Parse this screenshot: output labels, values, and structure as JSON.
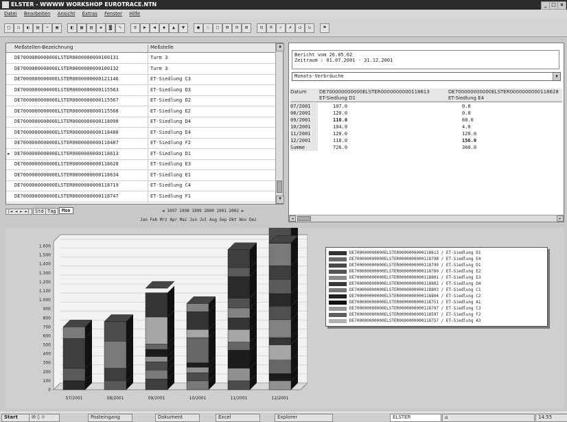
{
  "window": {
    "title": "ELSTER - WWWW WORKSHOP EUROTRACE.NTN"
  },
  "menu": [
    "Datei",
    "Bearbeiten",
    "Ansicht",
    "Extras",
    "Fenster",
    "Hilfe"
  ],
  "list": {
    "headers": [
      "Meßstellen-Bezeichnung",
      "Meßstelle"
    ],
    "rows": [
      {
        "id": "DE700000000000ELSTER0000000000100131",
        "name": "Turm 3"
      },
      {
        "id": "DE700000000000ELSTER0000000000100132",
        "name": "Turm 3"
      },
      {
        "id": "DE700000000000ELSTER0000000000121146",
        "name": "ET-Siedlung C3"
      },
      {
        "id": "DE700000000000ELSTER0000000000115563",
        "name": "ET-Siedlung D3"
      },
      {
        "id": "DE700000000000ELSTER0000000000115567",
        "name": "ET-Siedlung D2"
      },
      {
        "id": "DE700000000000ELSTER0000000000115568",
        "name": "ET-Siedlung E2"
      },
      {
        "id": "DE700000000000ELSTER0000000000118090",
        "name": "ET-Siedlung D4"
      },
      {
        "id": "DE700000000000ELSTER0000000000118480",
        "name": "ET-Siedlung E4"
      },
      {
        "id": "DE700000000000ELSTER0000000000118487",
        "name": "ET-Siedlung F2"
      },
      {
        "id": "DE700000000000ELSTER0000000000118613",
        "name": "ET-Siedlung D1"
      },
      {
        "id": "DE700000000000ELSTER0000000000118628",
        "name": "ET-Siedlung E3"
      },
      {
        "id": "DE700000000000ELSTER0000000000118634",
        "name": "ET-Siedlung E1"
      },
      {
        "id": "DE700000000000ELSTER0000000000118719",
        "name": "ET-Siedlung C4"
      },
      {
        "id": "DE700000000000ELSTER0000000000118747",
        "name": "ET-Siedlung F1"
      }
    ],
    "tabs": [
      "Std",
      "Tag",
      "Mon"
    ],
    "years": "◄ 1997 1998 1999 2000 2001 2002 ►",
    "months": "Jan Feb Mrz Apr Mai Jun Jul Aug Sep Okt Nov Dez"
  },
  "report": {
    "line1": "Bericht vom 26.05.02",
    "line2": "Zeitraum : 01.07.2001 - 31.12.2001",
    "dropdown": "Monats-Verbräuche"
  },
  "table": {
    "headers": [
      "Datum",
      "DE700000000000ELSTER0000000000118613",
      "DE700000000000ELSTER0000000000118628"
    ],
    "subheaders": [
      "",
      "ET-Siedlung D1",
      "ET-Siedlung E4"
    ],
    "rows": [
      [
        "07/2001",
        "107.0",
        "0.0"
      ],
      [
        "08/2001",
        "120.0",
        "0.0"
      ],
      [
        "09/2001",
        "110.0",
        "60.0"
      ],
      [
        "10/2001",
        "104.0",
        "4.0"
      ],
      [
        "11/2001",
        "120.0",
        "120.0"
      ],
      [
        "12/2001",
        "118.0",
        "156.0"
      ],
      [
        "Summe",
        "726.0",
        "360.0"
      ]
    ]
  },
  "chart_data": {
    "type": "bar",
    "stacked": true,
    "categories": [
      "07/2001",
      "08/2001",
      "09/2001",
      "10/2001",
      "11/2001",
      "12/2001"
    ],
    "yticks": [
      "0",
      "100",
      "200",
      "300",
      "400",
      "500",
      "600",
      "700",
      "800",
      "900",
      "1.000",
      "1.100",
      "1.200",
      "1.300",
      "1.400",
      "1.500",
      "1.600"
    ],
    "ylim": [
      0,
      1650
    ],
    "totals": [
      700,
      760,
      1130,
      960,
      1560,
      1640
    ],
    "grid": true,
    "legend_position": "right"
  },
  "chart_segments": [
    [
      100,
      140,
      330,
      130
    ],
    [
      100,
      140,
      300,
      220
    ],
    [
      120,
      100,
      90,
      60,
      80,
      60,
      300,
      270
    ],
    [
      100,
      90,
      60,
      50,
      280,
      90,
      200,
      90
    ],
    [
      100,
      140,
      200,
      90,
      140,
      130,
      110,
      110,
      240,
      100,
      200
    ],
    [
      100,
      80,
      150,
      170,
      80,
      200,
      150,
      140,
      160,
      150,
      250,
      210
    ]
  ],
  "legend": [
    {
      "label": "DE700000000000ELSTER0000000000118613 / ET-Siedlung D1",
      "color": "#333333"
    },
    {
      "label": "DE700000000000ELSTER0000000000118798 / ET-Siedlung E4",
      "color": "#6a6a6a"
    },
    {
      "label": "DE700000000000ELSTER0000000000118799 / ET-Siedlung D1",
      "color": "#4a4a4a"
    },
    {
      "label": "DE700000000000ELSTER0000000000118789 / ET-Siedlung E2",
      "color": "#555555"
    },
    {
      "label": "DE700000000000ELSTER0000000000118801 / ET-Siedlung E3",
      "color": "#8a8a8a"
    },
    {
      "label": "DE700000000000ELSTER0000000000118802 / ET-Siedlung D4",
      "color": "#3a3a3a"
    },
    {
      "label": "DE700000000000ELSTER0000000000118803 / ET-Siedlung C1",
      "color": "#777777"
    },
    {
      "label": "DE700000000000ELSTER0000000000118804 / ET-Siedlung C2",
      "color": "#222222"
    },
    {
      "label": "DE700000000000ELSTER0000000000118751 / ET-Siedlung A1",
      "color": "#111111"
    },
    {
      "label": "DE700000000000ELSTER0000000000118797 / ET-Siedlung C3",
      "color": "#999999"
    },
    {
      "label": "DE700000000000ELSTER0000000000118597 / ET-Siedlung F2",
      "color": "#5e5e5e"
    },
    {
      "label": "DE700000000000ELSTER0000000000118757 / ET-Siedlung A3",
      "color": "#b0b0b0"
    }
  ],
  "taskbar": {
    "start": "Start",
    "tasks": [
      "Posteingang",
      "Dokument",
      "Excel",
      "Explorer",
      "ELSTER"
    ],
    "clock": "14:55"
  }
}
